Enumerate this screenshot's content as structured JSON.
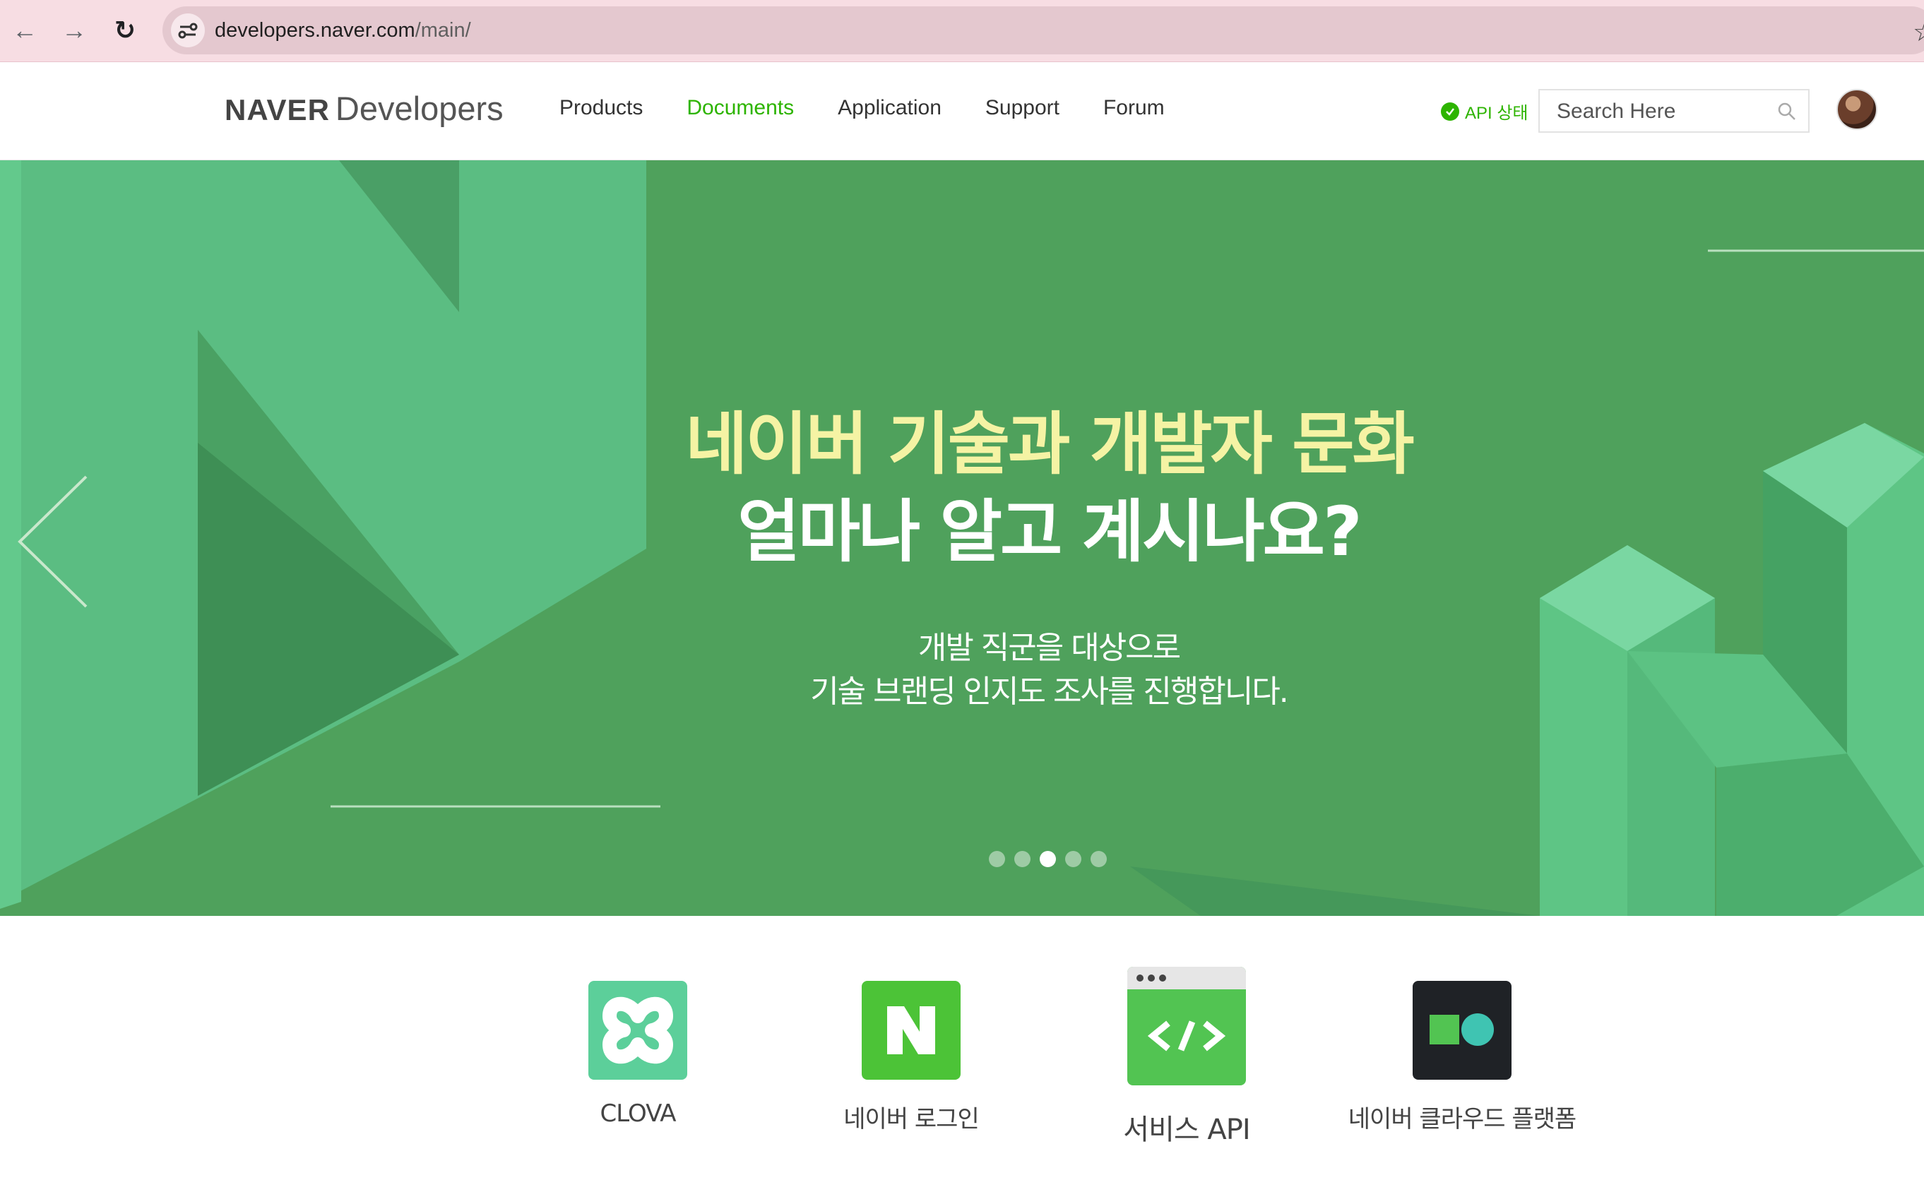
{
  "browser": {
    "url_host": "developers.naver.com",
    "url_path": "/main/"
  },
  "header": {
    "logo_brand": "NAVER",
    "logo_product": "Developers",
    "menu": [
      {
        "label": "Products"
      },
      {
        "label": "Documents"
      },
      {
        "label": "Application"
      },
      {
        "label": "Support"
      },
      {
        "label": "Forum"
      }
    ],
    "active_menu": "Documents",
    "api_status_label": "API 상태",
    "search_placeholder": "Search Here"
  },
  "hero": {
    "title_line1": "네이버 기술과 개발자 문화",
    "title_line2": "얼마나 알고 계시나요?",
    "subtitle_line1": "개발 직군을 대상으로",
    "subtitle_line2": "기술 브랜딩 인지도 조사를 진행합니다.",
    "slide_count": 5,
    "active_slide": 3,
    "colors": {
      "background": "#4fa15c",
      "title_highlight": "#f5f3a4",
      "shape_light": "#5fc083",
      "shape_dark": "#439a58"
    }
  },
  "products": [
    {
      "label": "CLOVA",
      "icon": "clova-icon",
      "color": "#5ccf9a"
    },
    {
      "label": "네이버 로그인",
      "icon": "naver-n-icon",
      "color": "#4cc337"
    },
    {
      "label": "서비스 API",
      "icon": "code-window-icon",
      "color": "#52c452"
    },
    {
      "label": "네이버 클라우드 플랫폼",
      "icon": "ncloud-icon",
      "color": "#1f2226"
    }
  ]
}
